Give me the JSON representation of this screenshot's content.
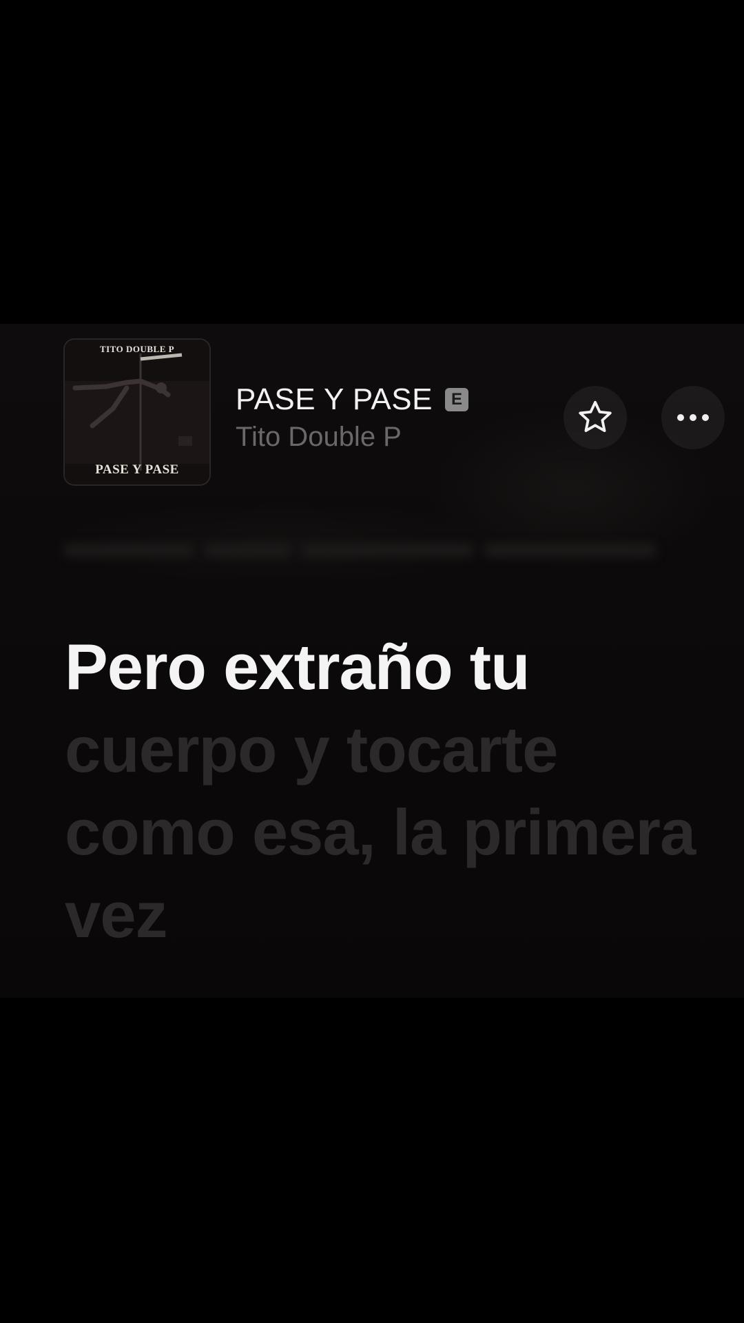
{
  "colors": {
    "background": "#000000",
    "panel": "#0d0b0b",
    "active_lyric": "#f4f4f4",
    "inactive_lyric": "#2b2929",
    "artist_text": "#6a6868"
  },
  "album_art": {
    "top_text": "TITO DOUBLE P",
    "bottom_text": "PASE Y PASE"
  },
  "track": {
    "title": "PASE Y PASE",
    "explicit_badge": "E",
    "artist": "Tito Double P"
  },
  "controls": {
    "favorite_icon": "star-icon",
    "more_icon": "more-options-icon"
  },
  "lyrics": {
    "active_line": "Pero extraño tu",
    "upcoming_lines": [
      "cuerpo y tocarte",
      "como esa, la primera",
      "vez"
    ]
  }
}
